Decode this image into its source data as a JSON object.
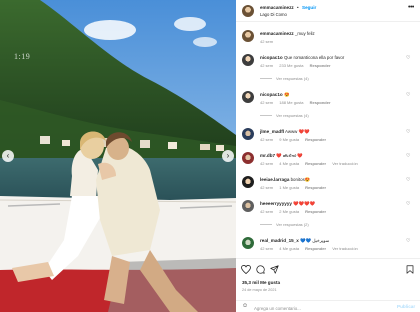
{
  "header": {
    "username": "emmacaminezz",
    "separator": "•",
    "follow_label": "Seguir",
    "location": "Lago Di Como",
    "more_label": "•••"
  },
  "photo": {
    "watermark": "1:19",
    "alt": "Pareja abrazada en un barco en el lago"
  },
  "caption": {
    "username": "emmacaminezz",
    "text": "_muy feliz",
    "time": "42 sem"
  },
  "comments": [
    {
      "username": "nicopac1o",
      "text": "Que romanticona ella por favor",
      "time": "42 sem",
      "likes": "233 Me gusta",
      "reply": "Responder",
      "view_replies": "Ver respuestas (4)"
    },
    {
      "username": "nicopac1o",
      "text": "😍",
      "time": "42 sem",
      "likes": "188 Me gusta",
      "reply": "Responder",
      "view_replies": "Ver respuestas (4)"
    },
    {
      "username": "jlme_madfl",
      "text": "Awww ❤️❤️",
      "time": "42 sem",
      "likes": "9 Me gusta",
      "reply": "Responder"
    },
    {
      "username": "mr.db7",
      "text": "❤️ 𝒹𝑒𝓈𝓉𝒾𝓃𝑜 ❤️",
      "time": "42 sem",
      "likes": "4 Me gusta",
      "reply": "Responder",
      "translate": "Ver traducción"
    },
    {
      "username": "leeiae.larraga",
      "text": "bonitos😍",
      "time": "42 sem",
      "likes": "1 Me gusta",
      "reply": "Responder"
    },
    {
      "username": "heeeerryyyyyy",
      "text": "❤️❤️❤️❤️",
      "time": "42 sem",
      "likes": "2 Me gusta",
      "reply": "Responder",
      "view_replies": "Ver respuestas (2)"
    },
    {
      "username": "real_madrid_15_x",
      "text": "💙💙 سوپرخیل",
      "time": "42 sem",
      "likes": "4 Me gusta",
      "reply": "Responder",
      "translate": "Ver traducción"
    }
  ],
  "footer": {
    "likes": "35,3 mil Me gusta",
    "date": "24 de mayo de 2021",
    "comment_placeholder": "Agrega un comentario...",
    "publish_label": "Publicar"
  },
  "colors": {
    "link": "#0095f6",
    "muted": "#8e8e8e",
    "publish_disabled": "#b2dffc"
  }
}
